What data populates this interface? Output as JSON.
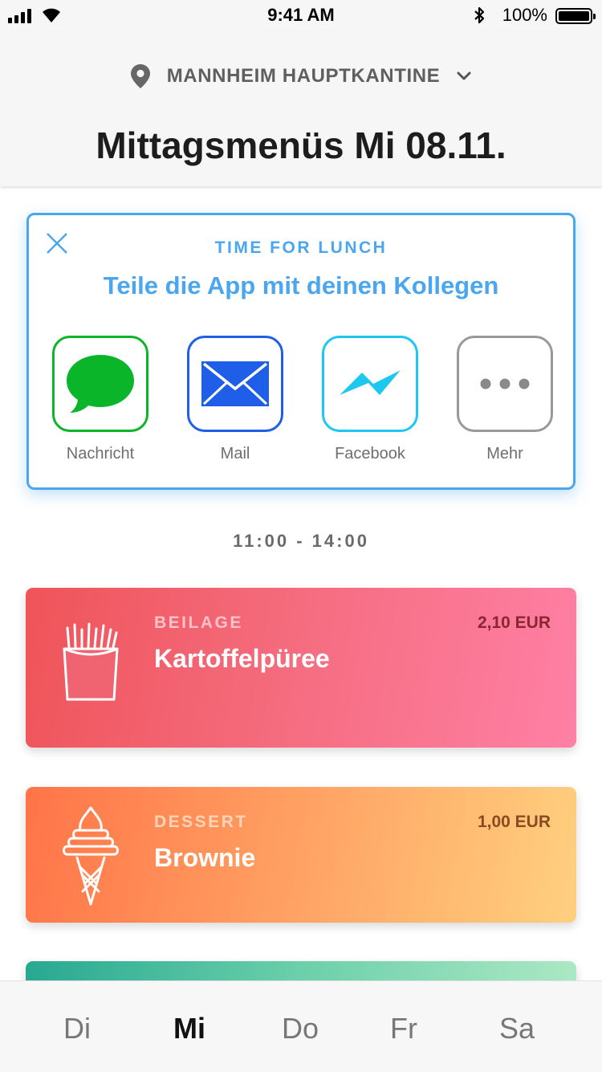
{
  "status_bar": {
    "time": "9:41 AM",
    "battery_percent": "100%",
    "battery_level": 1.0
  },
  "header": {
    "location": "MANNHEIM HAUPTKANTINE",
    "title": "Mittagsmenüs Mi 08.11."
  },
  "share_card": {
    "eyebrow": "TIME FOR LUNCH",
    "title": "Teile die App mit deinen Kollegen",
    "accent_color": "#4aa6ee",
    "options": [
      {
        "label": "Nachricht",
        "icon": "message-bubble-icon",
        "color": "#0bb52a"
      },
      {
        "label": "Mail",
        "icon": "mail-envelope-icon",
        "color": "#1e5ee8"
      },
      {
        "label": "Facebook",
        "icon": "messenger-icon",
        "color": "#1dc7ef"
      },
      {
        "label": "Mehr",
        "icon": "more-dots-icon",
        "color": "#999999"
      }
    ]
  },
  "hours": "11:00 - 14:00",
  "menu_items": [
    {
      "category": "BEILAGE",
      "name": "Kartoffelpüree",
      "price": "2,10 EUR",
      "icon": "french-fries-icon"
    },
    {
      "category": "DESSERT",
      "name": "Brownie",
      "price": "1,00 EUR",
      "icon": "ice-cream-cone-icon"
    }
  ],
  "tabs": [
    {
      "label": "Di",
      "active": false
    },
    {
      "label": "Mi",
      "active": true
    },
    {
      "label": "Do",
      "active": false
    },
    {
      "label": "Fr",
      "active": false
    },
    {
      "label": "Sa",
      "active": false
    }
  ]
}
